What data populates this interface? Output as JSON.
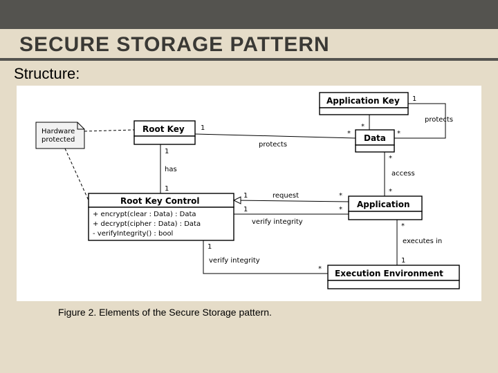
{
  "title": "SECURE STORAGE PATTERN",
  "subtitle": "Structure:",
  "caption": "Figure 2. Elements of the Secure Storage pattern.",
  "diagram": {
    "classes": {
      "hardware_protected": "Hardware\nprotected",
      "root_key": "Root Key",
      "app_key": "Application Key",
      "data": "Data",
      "rkc": "Root Key Control",
      "rkc_ops": [
        "+ encrypt(clear : Data) : Data",
        "+ decrypt(cipher : Data) : Data",
        "- verifyIntegrity() : bool"
      ],
      "application": "Application",
      "exec_env": "Execution Environment"
    },
    "assoc": {
      "protects_top": {
        "label": "protects",
        "left": "1",
        "right": "*"
      },
      "rk_data": {
        "label": "protects",
        "left": "1",
        "right": "*"
      },
      "has": {
        "label": "has",
        "top": "1",
        "bottom": "1"
      },
      "access": {
        "label": "access",
        "top": "*",
        "bottom": "*"
      },
      "request": {
        "label": "request",
        "left": "1",
        "right": "*"
      },
      "verify_app": {
        "label": "verify integrity",
        "left": "1",
        "right": "*"
      },
      "verify_env": {
        "label": "verify integrity",
        "left": "1",
        "right": "*"
      },
      "executes": {
        "label": "executes in",
        "top": "*",
        "bottom": "1"
      }
    }
  }
}
